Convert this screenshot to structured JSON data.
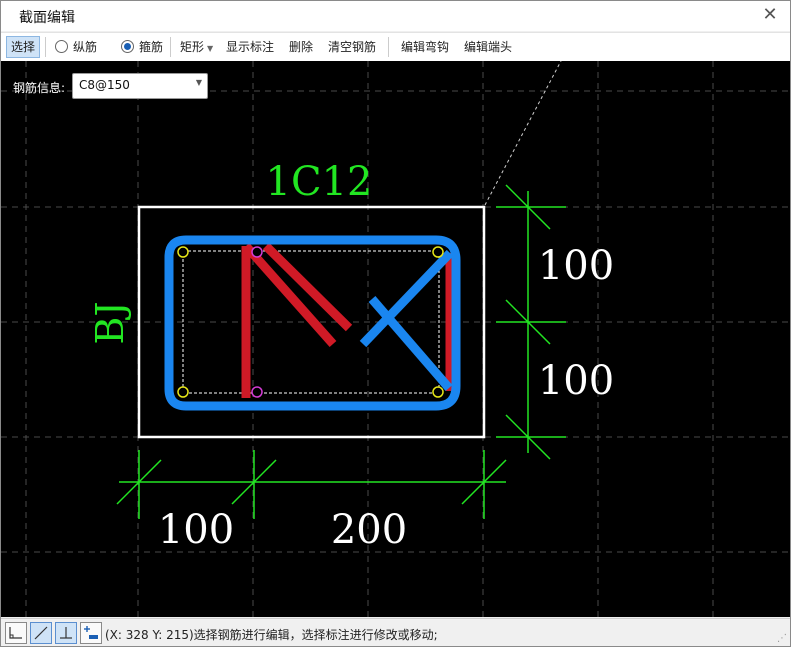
{
  "window": {
    "title": "截面编辑"
  },
  "toolbar": {
    "select_label": "选择",
    "longitudinal_label": "纵筋",
    "stirrup_label": "箍筋",
    "rect_label": "矩形",
    "show_annotation_label": "显示标注",
    "delete_label": "删除",
    "clear_rebar_label": "清空钢筋",
    "edit_hook_label": "编辑弯钩",
    "edit_end_label": "编辑端头"
  },
  "rebar_info": {
    "label": "钢筋信息:",
    "value": "C8@150"
  },
  "drawing": {
    "top_label": "1C12",
    "side_label": "BJ",
    "dim_right": [
      "100",
      "100"
    ],
    "dim_bottom": [
      "100",
      "200"
    ],
    "colors": {
      "longitudinal": "#d01a26",
      "stirrup": "#1a86f0",
      "dimension": "#22e622",
      "outline": "#ffffff"
    }
  },
  "status": {
    "text": "(X: 328 Y: 215)选择钢筋进行编辑，选择标注进行修改或移动;"
  },
  "icons": [
    "close-icon",
    "caret-down-icon",
    "ortho-icon",
    "line-icon",
    "perpendicular-icon",
    "add-icon"
  ]
}
